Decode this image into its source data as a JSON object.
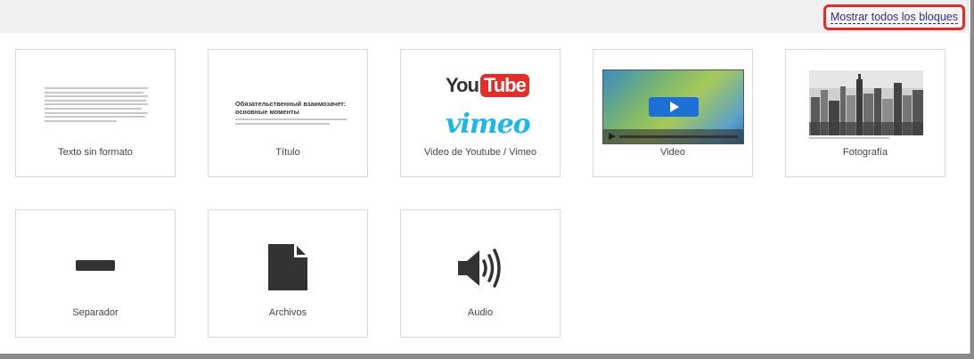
{
  "header": {
    "show_all_label": "Mostrar todos los bloques"
  },
  "blocks": [
    {
      "label": "Texto sin formato",
      "icon": "plain-text-preview"
    },
    {
      "label": "Título",
      "icon": "title-preview",
      "preview_heading": "Обязательственный взаимозачет: основные моменты"
    },
    {
      "label": "Video de Youtube / Vimeo",
      "icon": "youtube-vimeo-logo",
      "logo_youtube_a": "You",
      "logo_youtube_b": "Tube",
      "logo_vimeo": "vimeo"
    },
    {
      "label": "Video",
      "icon": "video-player-preview"
    },
    {
      "label": "Fotografía",
      "icon": "city-photo-preview"
    },
    {
      "label": "Separador",
      "icon": "separator-icon"
    },
    {
      "label": "Archivos",
      "icon": "file-icon"
    },
    {
      "label": "Audio",
      "icon": "speaker-icon"
    }
  ],
  "colors": {
    "accent_link": "#2d2f8f",
    "highlight_border": "#e02b2b",
    "youtube_red": "#e52d27",
    "vimeo_blue": "#1ab7ea",
    "play_button": "#1e6fd6"
  }
}
